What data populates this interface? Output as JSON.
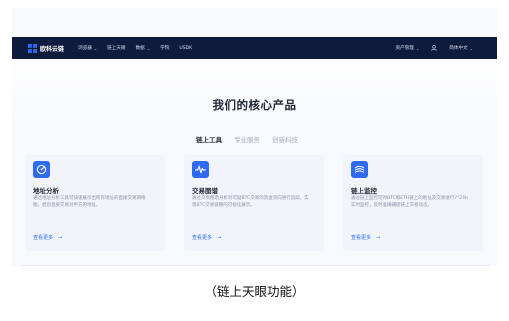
{
  "nav": {
    "brand": "欧科云链",
    "menu": [
      {
        "label": "浏览器",
        "has_caret": true
      },
      {
        "label": "链上天眼",
        "has_caret": false
      },
      {
        "label": "数据",
        "has_caret": true
      },
      {
        "label": "学院",
        "has_caret": false
      },
      {
        "label": "USDK",
        "has_caret": false
      }
    ],
    "asset_mgmt": "资产管理",
    "language": "简体中文",
    "caret": "⌄"
  },
  "headline": "我们的核心产品",
  "tabs": [
    {
      "label": "链上工具",
      "active": true
    },
    {
      "label": "专业服务",
      "active": false
    },
    {
      "label": "创新科技",
      "active": false
    }
  ],
  "cards": [
    {
      "icon": "speedometer-icon",
      "title": "地址分析",
      "desc": "通过地址分析工具可快速展示出所有地址的直接交易网络图，尝您直接交易对手方的地址。",
      "link": "查看更多",
      "arrow": "→"
    },
    {
      "icon": "pulse-icon",
      "title": "交易图谱",
      "desc": "通过交易图谱分析对可疑BTC交易的资金流向进行追踪，实现BTC交易链路的可视化展示。",
      "link": "查看更多",
      "arrow": "→"
    },
    {
      "icon": "monitor-waves-icon",
      "title": "链上监控",
      "desc": "通过链上监控可对BTC和ETH链上的地址及交易进行7*24h实时监控，及时准确捕捉链上交易动态。",
      "link": "查看更多",
      "arrow": "→"
    }
  ],
  "caption": "（链上天眼功能）",
  "colors": {
    "nav_bg": "#0f1b3d",
    "accent": "#2f6bf2",
    "card_bg": "#f1f4fa",
    "page_bg": "#f7f9fc"
  }
}
